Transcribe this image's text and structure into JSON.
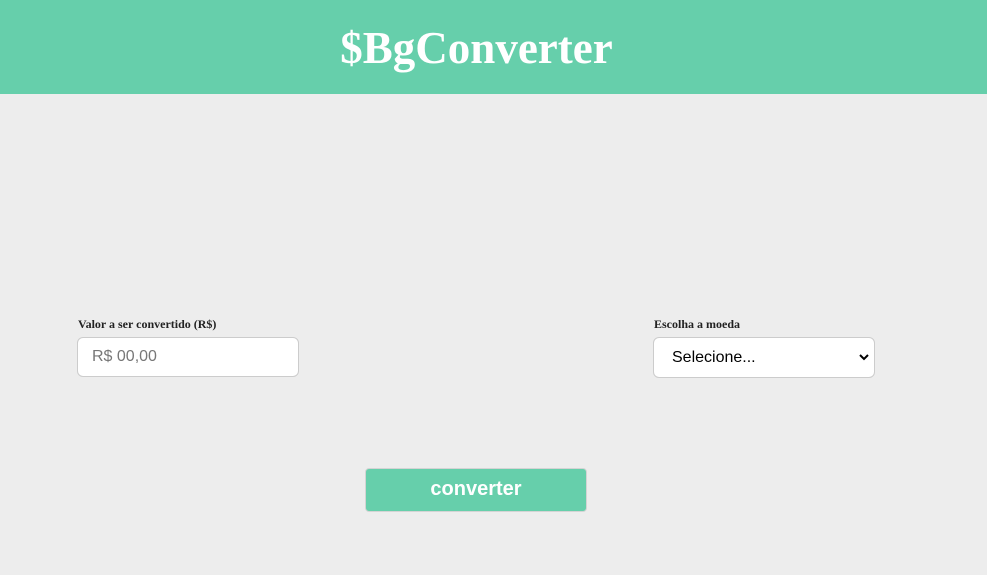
{
  "header": {
    "logo_text": "$BgConverter"
  },
  "form": {
    "amount": {
      "label": "Valor a ser convertido (R$)",
      "placeholder": "R$ 00,00",
      "value": ""
    },
    "currency": {
      "label": "Escolha a moeda",
      "selected": "Selecione..."
    },
    "convert_label": "converter"
  },
  "colors": {
    "accent": "#66cfab",
    "background": "#ededed"
  },
  "icons": {
    "currency_dropdown": "chevron-down-icon"
  }
}
